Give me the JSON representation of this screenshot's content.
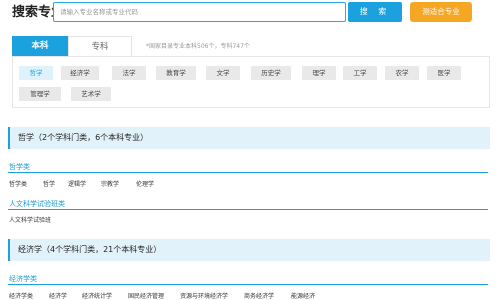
{
  "search": {
    "title": "搜索专业",
    "placeholder": "请输入专业名称或专业代码",
    "search_label": "搜 索",
    "match_label": "测适合专业"
  },
  "tabs": {
    "active": "本科",
    "inactive": "专科",
    "note": "*国家目录专业本科506个，专科747个"
  },
  "categories": [
    "哲学",
    "经济学",
    "法学",
    "教育学",
    "文学",
    "历史学",
    "理学",
    "工学",
    "农学",
    "医学",
    "管理学",
    "艺术学"
  ],
  "selected_category": "哲学",
  "sections": [
    {
      "header": "哲学（2个学科门类，6个本科专业）",
      "groups": [
        {
          "title": "哲学类",
          "majors": [
            "哲学类",
            "哲学",
            "逻辑学",
            "宗教学",
            "伦理学"
          ]
        },
        {
          "title": "人文科学试验班类",
          "majors": [
            "人文科学试验班"
          ]
        }
      ]
    },
    {
      "header": "经济学（4个学科门类，21个本科专业）",
      "groups": [
        {
          "title": "经济学类",
          "majors": [
            "经济学类",
            "经济学",
            "经济统计学",
            "国民经济管理",
            "资源与环境经济学",
            "商务经济学",
            "能源经济"
          ]
        }
      ]
    }
  ],
  "colors": {
    "accent": "#1aa1de",
    "match_button": "#f5a623",
    "section_bg": "#e2f2fa"
  }
}
